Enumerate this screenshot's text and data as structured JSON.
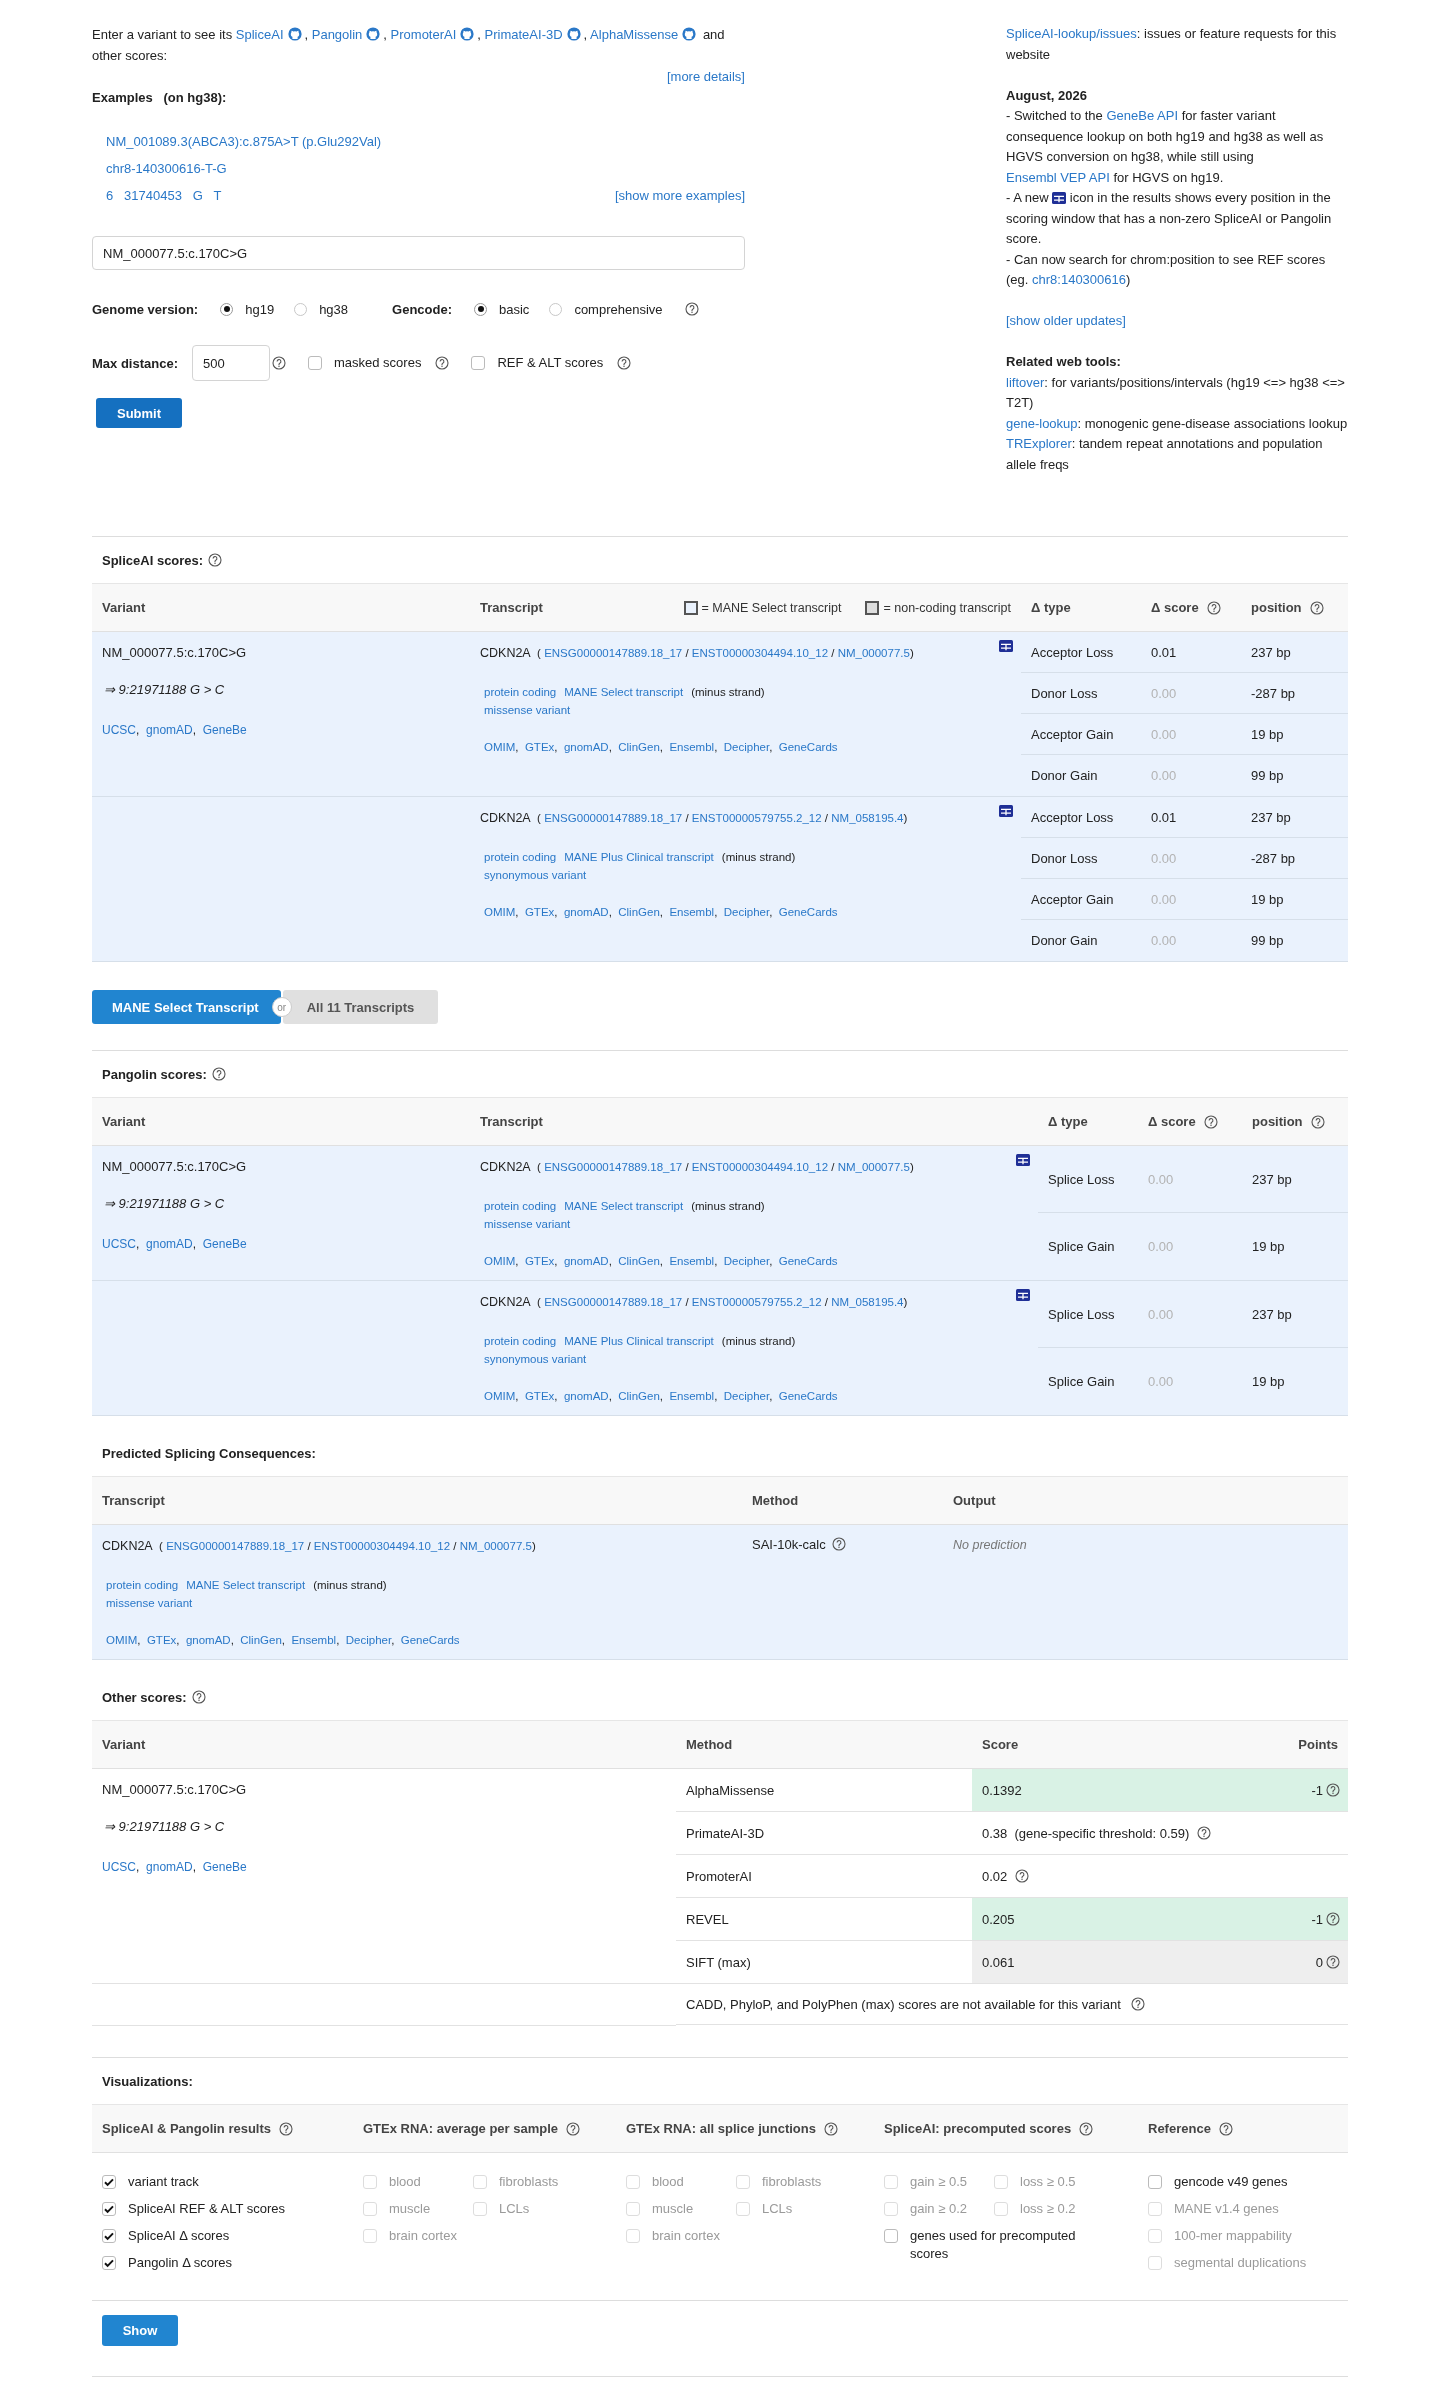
{
  "intro": [
    {
      "kind": "text",
      "text": "Enter a variant to see its "
    },
    {
      "kind": "link",
      "text": "SpliceAI"
    },
    {
      "kind": "github"
    },
    {
      "kind": "text",
      "text": ", "
    },
    {
      "kind": "link",
      "text": "Pangolin"
    },
    {
      "kind": "github"
    },
    {
      "kind": "text",
      "text": ", "
    },
    {
      "kind": "link",
      "text": "PromoterAI"
    },
    {
      "kind": "github"
    },
    {
      "kind": "text",
      "text": ", "
    },
    {
      "kind": "link",
      "text": "PrimateAI-3D"
    },
    {
      "kind": "github"
    },
    {
      "kind": "text",
      "text": ", "
    },
    {
      "kind": "link",
      "text": "AlphaMissense"
    },
    {
      "kind": "github"
    },
    {
      "kind": "text",
      "text": " and other scores:"
    }
  ],
  "more_details": "[more details]",
  "examples": {
    "title": "Examples   (on hg38):",
    "items": [
      "NM_001089.3(ABCA3):c.875A>T (p.Glu292Val)",
      "chr8-140300616-T-G",
      "6   31740453   G   T"
    ],
    "more": "[show more examples]"
  },
  "variant_input": {
    "value": "NM_000077.5:c.170C>G"
  },
  "genome": {
    "label": "Genome version:",
    "options": [
      {
        "label": "hg19",
        "selected": true
      },
      {
        "label": "hg38",
        "selected": false
      }
    ]
  },
  "gencode": {
    "label": "Gencode:",
    "help": true,
    "options": [
      {
        "label": "basic",
        "selected": true
      },
      {
        "label": "comprehensive",
        "selected": false
      }
    ]
  },
  "max_distance": {
    "label": "Max distance:",
    "value": "500",
    "help": true
  },
  "toggles": [
    {
      "label": "masked scores",
      "checked": false,
      "help": true
    },
    {
      "label": "REF & ALT scores",
      "checked": false,
      "help": true
    }
  ],
  "submit": "Submit",
  "sidebar": [
    {
      "lines": [
        [
          {
            "kind": "link",
            "text": "SpliceAI-lookup/issues"
          },
          {
            "kind": "text",
            "text": ": issues or feature requests for this website"
          }
        ]
      ]
    },
    {
      "heading": "August, 2026",
      "lines": [
        [
          {
            "kind": "text",
            "text": "- Switched to the "
          },
          {
            "kind": "link",
            "text": "GeneBe API"
          },
          {
            "kind": "text",
            "text": " for faster variant consequence lookup on both hg19 and hg38 as well as HGVS conversion on hg38, while still using "
          },
          {
            "kind": "link",
            "text": "Ensembl VEP API"
          },
          {
            "kind": "text",
            "text": " for HGVS on hg19."
          }
        ],
        [
          {
            "kind": "text",
            "text": "- A new "
          },
          {
            "kind": "grid"
          },
          {
            "kind": "text",
            "text": " icon in the results shows every position in the scoring window that has a non-zero SpliceAI or Pangolin score."
          }
        ],
        [
          {
            "kind": "text",
            "text": "- Can now search for chrom:position to see REF scores (eg. "
          },
          {
            "kind": "link",
            "text": "chr8:140300616"
          },
          {
            "kind": "text",
            "text": ")"
          }
        ]
      ]
    },
    {
      "lines": [
        [
          {
            "kind": "link",
            "text": "[show older updates]"
          }
        ]
      ]
    },
    {
      "heading": "Related web tools:",
      "lines": [
        [
          {
            "kind": "link",
            "text": "liftover"
          },
          {
            "kind": "text",
            "text": ": for variants/positions/intervals (hg19 <=> hg38 <=> T2T)"
          }
        ],
        [
          {
            "kind": "link",
            "text": "gene-lookup"
          },
          {
            "kind": "text",
            "text": ": monogenic gene-disease associations lookup"
          }
        ],
        [
          {
            "kind": "link",
            "text": "TRExplorer"
          },
          {
            "kind": "text",
            "text": ": tandem repeat annotations and population allele freqs"
          }
        ]
      ]
    }
  ],
  "spliceai": {
    "title": "SpliceAI scores:",
    "help": true,
    "columns": [
      {
        "label": "Variant",
        "help": false
      },
      {
        "label": "Transcript",
        "help": false
      },
      {
        "label": "Δ type",
        "help": false
      },
      {
        "label": "Δ score",
        "help": true
      },
      {
        "label": "position",
        "help": true
      }
    ],
    "legend": [
      {
        "label": "= MANE Select transcript",
        "kind": "mane"
      },
      {
        "label": "= non-coding transcript",
        "kind": "noncoding"
      }
    ],
    "variant": {
      "name": "NM_000077.5:c.170C>G",
      "position": "⇒ 9:21971188 G > C",
      "links": [
        {
          "kind": "link",
          "text": "UCSC"
        },
        {
          "kind": "text",
          "text": ",  "
        },
        {
          "kind": "link",
          "text": "gnomAD"
        },
        {
          "kind": "text",
          "text": ",  "
        },
        {
          "kind": "link",
          "text": "GeneBe"
        }
      ]
    },
    "transcripts": [
      {
        "gene": "CDKN2A",
        "ids": [
          {
            "kind": "text",
            "text": "  ( "
          },
          {
            "kind": "link",
            "text": "ENSG00000147889.18_17"
          },
          {
            "kind": "text",
            "text": " / "
          },
          {
            "kind": "link",
            "text": "ENST00000304494.10_12"
          },
          {
            "kind": "text",
            "text": " / "
          },
          {
            "kind": "link",
            "text": "NM_000077.5"
          },
          {
            "kind": "text",
            "text": ")"
          }
        ],
        "tags": [
          {
            "kind": "link",
            "text": "protein coding"
          },
          {
            "kind": "link",
            "text": "MANE Select transcript"
          },
          {
            "kind": "text",
            "text": "(minus strand)"
          }
        ],
        "consequence": "missense variant",
        "links": [
          {
            "kind": "link",
            "text": "OMIM"
          },
          {
            "kind": "text",
            "text": ",  "
          },
          {
            "kind": "link",
            "text": "GTEx"
          },
          {
            "kind": "text",
            "text": ",  "
          },
          {
            "kind": "link",
            "text": "gnomAD"
          },
          {
            "kind": "text",
            "text": ",  "
          },
          {
            "kind": "link",
            "text": "ClinGen"
          },
          {
            "kind": "text",
            "text": ",  "
          },
          {
            "kind": "link",
            "text": "Ensembl"
          },
          {
            "kind": "text",
            "text": ",  "
          },
          {
            "kind": "link",
            "text": "Decipher"
          },
          {
            "kind": "text",
            "text": ",  "
          },
          {
            "kind": "link",
            "text": "GeneCards"
          }
        ],
        "scores": [
          {
            "type": "Acceptor Loss",
            "score": "0.01",
            "muted": false,
            "position": "237 bp"
          },
          {
            "type": "Donor Loss",
            "score": "0.00",
            "muted": true,
            "position": "-287 bp"
          },
          {
            "type": "Acceptor Gain",
            "score": "0.00",
            "muted": true,
            "position": "19 bp"
          },
          {
            "type": "Donor Gain",
            "score": "0.00",
            "muted": true,
            "position": "99 bp"
          }
        ]
      },
      {
        "gene": "CDKN2A",
        "ids": [
          {
            "kind": "text",
            "text": "  ( "
          },
          {
            "kind": "link",
            "text": "ENSG00000147889.18_17"
          },
          {
            "kind": "text",
            "text": " / "
          },
          {
            "kind": "link",
            "text": "ENST00000579755.2_12"
          },
          {
            "kind": "text",
            "text": " / "
          },
          {
            "kind": "link",
            "text": "NM_058195.4"
          },
          {
            "kind": "text",
            "text": ")"
          }
        ],
        "tags": [
          {
            "kind": "link",
            "text": "protein coding"
          },
          {
            "kind": "link",
            "text": "MANE Plus Clinical transcript"
          },
          {
            "kind": "text",
            "text": "(minus strand)"
          }
        ],
        "consequence": "synonymous variant",
        "links": [
          {
            "kind": "link",
            "text": "OMIM"
          },
          {
            "kind": "text",
            "text": ",  "
          },
          {
            "kind": "link",
            "text": "GTEx"
          },
          {
            "kind": "text",
            "text": ",  "
          },
          {
            "kind": "link",
            "text": "gnomAD"
          },
          {
            "kind": "text",
            "text": ",  "
          },
          {
            "kind": "link",
            "text": "ClinGen"
          },
          {
            "kind": "text",
            "text": ",  "
          },
          {
            "kind": "link",
            "text": "Ensembl"
          },
          {
            "kind": "text",
            "text": ",  "
          },
          {
            "kind": "link",
            "text": "Decipher"
          },
          {
            "kind": "text",
            "text": ",  "
          },
          {
            "kind": "link",
            "text": "GeneCards"
          }
        ],
        "scores": [
          {
            "type": "Acceptor Loss",
            "score": "0.01",
            "muted": false,
            "position": "237 bp"
          },
          {
            "type": "Donor Loss",
            "score": "0.00",
            "muted": true,
            "position": "-287 bp"
          },
          {
            "type": "Acceptor Gain",
            "score": "0.00",
            "muted": true,
            "position": "19 bp"
          },
          {
            "type": "Donor Gain",
            "score": "0.00",
            "muted": true,
            "position": "99 bp"
          }
        ]
      }
    ]
  },
  "transcript_toggle": {
    "separator": "or",
    "options": [
      {
        "label": "MANE Select Transcript",
        "selected": true
      },
      {
        "label": "All 11 Transcripts",
        "selected": false
      }
    ]
  },
  "pangolin": {
    "title": "Pangolin scores:",
    "help": true,
    "columns": [
      {
        "label": "Variant",
        "help": false
      },
      {
        "label": "Transcript",
        "help": false
      },
      {
        "label": "Δ type",
        "help": false
      },
      {
        "label": "Δ score",
        "help": true
      },
      {
        "label": "position",
        "help": true
      }
    ],
    "variant": {
      "name": "NM_000077.5:c.170C>G",
      "position": "⇒ 9:21971188 G > C",
      "links": [
        {
          "kind": "link",
          "text": "UCSC"
        },
        {
          "kind": "text",
          "text": ",  "
        },
        {
          "kind": "link",
          "text": "gnomAD"
        },
        {
          "kind": "text",
          "text": ",  "
        },
        {
          "kind": "link",
          "text": "GeneBe"
        }
      ]
    },
    "transcripts": [
      {
        "gene": "CDKN2A",
        "ids": [
          {
            "kind": "text",
            "text": "  ( "
          },
          {
            "kind": "link",
            "text": "ENSG00000147889.18_17"
          },
          {
            "kind": "text",
            "text": " / "
          },
          {
            "kind": "link",
            "text": "ENST00000304494.10_12"
          },
          {
            "kind": "text",
            "text": " / "
          },
          {
            "kind": "link",
            "text": "NM_000077.5"
          },
          {
            "kind": "text",
            "text": ")"
          }
        ],
        "tags": [
          {
            "kind": "link",
            "text": "protein coding"
          },
          {
            "kind": "link",
            "text": "MANE Select transcript"
          },
          {
            "kind": "text",
            "text": "(minus strand)"
          }
        ],
        "consequence": "missense variant",
        "links": [
          {
            "kind": "link",
            "text": "OMIM"
          },
          {
            "kind": "text",
            "text": ",  "
          },
          {
            "kind": "link",
            "text": "GTEx"
          },
          {
            "kind": "text",
            "text": ",  "
          },
          {
            "kind": "link",
            "text": "gnomAD"
          },
          {
            "kind": "text",
            "text": ",  "
          },
          {
            "kind": "link",
            "text": "ClinGen"
          },
          {
            "kind": "text",
            "text": ",  "
          },
          {
            "kind": "link",
            "text": "Ensembl"
          },
          {
            "kind": "text",
            "text": ",  "
          },
          {
            "kind": "link",
            "text": "Decipher"
          },
          {
            "kind": "text",
            "text": ",  "
          },
          {
            "kind": "link",
            "text": "GeneCards"
          }
        ],
        "scores": [
          {
            "type": "Splice Loss",
            "score": "0.00",
            "muted": true,
            "position": "237 bp"
          },
          {
            "type": "Splice Gain",
            "score": "0.00",
            "muted": true,
            "position": "19 bp"
          }
        ]
      },
      {
        "gene": "CDKN2A",
        "ids": [
          {
            "kind": "text",
            "text": "  ( "
          },
          {
            "kind": "link",
            "text": "ENSG00000147889.18_17"
          },
          {
            "kind": "text",
            "text": " / "
          },
          {
            "kind": "link",
            "text": "ENST00000579755.2_12"
          },
          {
            "kind": "text",
            "text": " / "
          },
          {
            "kind": "link",
            "text": "NM_058195.4"
          },
          {
            "kind": "text",
            "text": ")"
          }
        ],
        "tags": [
          {
            "kind": "link",
            "text": "protein coding"
          },
          {
            "kind": "link",
            "text": "MANE Plus Clinical transcript"
          },
          {
            "kind": "text",
            "text": "(minus strand)"
          }
        ],
        "consequence": "synonymous variant",
        "links": [
          {
            "kind": "link",
            "text": "OMIM"
          },
          {
            "kind": "text",
            "text": ",  "
          },
          {
            "kind": "link",
            "text": "GTEx"
          },
          {
            "kind": "text",
            "text": ",  "
          },
          {
            "kind": "link",
            "text": "gnomAD"
          },
          {
            "kind": "text",
            "text": ",  "
          },
          {
            "kind": "link",
            "text": "ClinGen"
          },
          {
            "kind": "text",
            "text": ",  "
          },
          {
            "kind": "link",
            "text": "Ensembl"
          },
          {
            "kind": "text",
            "text": ",  "
          },
          {
            "kind": "link",
            "text": "Decipher"
          },
          {
            "kind": "text",
            "text": ",  "
          },
          {
            "kind": "link",
            "text": "GeneCards"
          }
        ],
        "scores": [
          {
            "type": "Splice Loss",
            "score": "0.00",
            "muted": true,
            "position": "237 bp"
          },
          {
            "type": "Splice Gain",
            "score": "0.00",
            "muted": true,
            "position": "19 bp"
          }
        ]
      }
    ]
  },
  "predicted": {
    "title": "Predicted Splicing Consequences:",
    "columns": [
      {
        "label": "Transcript"
      },
      {
        "label": "Method"
      },
      {
        "label": "Output"
      }
    ],
    "rows": [
      {
        "transcript": {
          "gene": "CDKN2A",
          "ids": [
            {
              "kind": "text",
              "text": "  ( "
            },
            {
              "kind": "link",
              "text": "ENSG00000147889.18_17"
            },
            {
              "kind": "text",
              "text": " / "
            },
            {
              "kind": "link",
              "text": "ENST00000304494.10_12"
            },
            {
              "kind": "text",
              "text": " / "
            },
            {
              "kind": "link",
              "text": "NM_000077.5"
            },
            {
              "kind": "text",
              "text": ")"
            }
          ],
          "tags": [
            {
              "kind": "link",
              "text": "protein coding"
            },
            {
              "kind": "link",
              "text": "MANE Select transcript"
            },
            {
              "kind": "text",
              "text": "(minus strand)"
            }
          ],
          "consequence": "missense variant",
          "links": [
            {
              "kind": "link",
              "text": "OMIM"
            },
            {
              "kind": "text",
              "text": ",  "
            },
            {
              "kind": "link",
              "text": "GTEx"
            },
            {
              "kind": "text",
              "text": ",  "
            },
            {
              "kind": "link",
              "text": "gnomAD"
            },
            {
              "kind": "text",
              "text": ",  "
            },
            {
              "kind": "link",
              "text": "ClinGen"
            },
            {
              "kind": "text",
              "text": ",  "
            },
            {
              "kind": "link",
              "text": "Ensembl"
            },
            {
              "kind": "text",
              "text": ",  "
            },
            {
              "kind": "link",
              "text": "Decipher"
            },
            {
              "kind": "text",
              "text": ",  "
            },
            {
              "kind": "link",
              "text": "GeneCards"
            }
          ]
        },
        "method": "SAI-10k-calc",
        "method_help": true,
        "output": "No prediction"
      }
    ]
  },
  "other": {
    "title": "Other scores:",
    "help": true,
    "columns": [
      {
        "label": "Variant"
      },
      {
        "label": "Method"
      },
      {
        "label": "Score"
      },
      {
        "label": "Points"
      }
    ],
    "variant": {
      "name": "NM_000077.5:c.170C>G",
      "position": "⇒ 9:21971188 G > C",
      "links": [
        {
          "kind": "link",
          "text": "UCSC"
        },
        {
          "kind": "text",
          "text": ",  "
        },
        {
          "kind": "link",
          "text": "gnomAD"
        },
        {
          "kind": "text",
          "text": ",  "
        },
        {
          "kind": "link",
          "text": "GeneBe"
        }
      ]
    },
    "rows": [
      {
        "method": "AlphaMissense",
        "score": "0.1392",
        "score_help": false,
        "points": "-1",
        "color": "#d9f2e5"
      },
      {
        "method": "PrimateAI-3D",
        "score": "0.38  (gene-specific threshold: 0.59)",
        "score_help": true
      },
      {
        "method": "PromoterAI",
        "score": "0.02",
        "score_help": true
      },
      {
        "method": "REVEL",
        "score": "0.205",
        "score_help": false,
        "points": "-1",
        "color": "#d9f2e5"
      },
      {
        "method": "SIFT (max)",
        "score": "0.061",
        "score_help": false,
        "points": "0",
        "color": "#eeeeee"
      }
    ],
    "note": "CADD, PhyloP, and PolyPhen (max) scores are not available for this variant",
    "note_help": true
  },
  "visualizations": {
    "title": "Visualizations:",
    "button": "Show",
    "groups": [
      {
        "label": "SpliceAI & Pangolin results",
        "help": true,
        "kind": "list",
        "items": [
          {
            "label": "variant track",
            "checked": true,
            "disabled": false
          },
          {
            "label": "SpliceAI REF & ALT scores",
            "checked": true,
            "disabled": false
          },
          {
            "label": "SpliceAI Δ  scores",
            "checked": true,
            "disabled": false
          },
          {
            "label": "Pangolin Δ  scores",
            "checked": true,
            "disabled": false
          }
        ]
      },
      {
        "label": "GTEx RNA: average per sample",
        "help": true,
        "kind": "grid",
        "items": [
          {
            "label": "blood",
            "checked": false,
            "disabled": true,
            "wide": false
          },
          {
            "label": "fibroblasts",
            "checked": false,
            "disabled": true,
            "wide": false
          },
          {
            "label": "muscle",
            "checked": false,
            "disabled": true,
            "wide": false
          },
          {
            "label": "LCLs",
            "checked": false,
            "disabled": true,
            "wide": false
          },
          {
            "label": "brain cortex",
            "checked": false,
            "disabled": true,
            "wide": false
          }
        ]
      },
      {
        "label": "GTEx RNA: all splice junctions",
        "help": true,
        "kind": "grid",
        "items": [
          {
            "label": "blood",
            "checked": false,
            "disabled": true,
            "wide": false
          },
          {
            "label": "fibroblasts",
            "checked": false,
            "disabled": true,
            "wide": false
          },
          {
            "label": "muscle",
            "checked": false,
            "disabled": true,
            "wide": false
          },
          {
            "label": "LCLs",
            "checked": false,
            "disabled": true,
            "wide": false
          },
          {
            "label": "brain cortex",
            "checked": false,
            "disabled": true,
            "wide": false
          }
        ]
      },
      {
        "label": "SpliceAI: precomputed scores",
        "help": true,
        "kind": "grid",
        "items": [
          {
            "label": "gain ≥ 0.5",
            "checked": false,
            "disabled": true,
            "wide": false
          },
          {
            "label": "loss ≥ 0.5",
            "checked": false,
            "disabled": true,
            "wide": false
          },
          {
            "label": "gain ≥ 0.2",
            "checked": false,
            "disabled": true,
            "wide": false
          },
          {
            "label": "loss ≥ 0.2",
            "checked": false,
            "disabled": true,
            "wide": false
          },
          {
            "label": "genes used for precomputed scores",
            "checked": false,
            "disabled": false,
            "wide": true
          }
        ]
      },
      {
        "label": "Reference",
        "help": true,
        "kind": "list",
        "items": [
          {
            "label": "gencode v49 genes",
            "checked": false,
            "disabled": false
          },
          {
            "label": "MANE v1.4 genes",
            "checked": false,
            "disabled": true
          },
          {
            "label": "100-mer mappability",
            "checked": false,
            "disabled": true
          },
          {
            "label": "segmental duplications",
            "checked": false,
            "disabled": true
          }
        ]
      }
    ]
  }
}
